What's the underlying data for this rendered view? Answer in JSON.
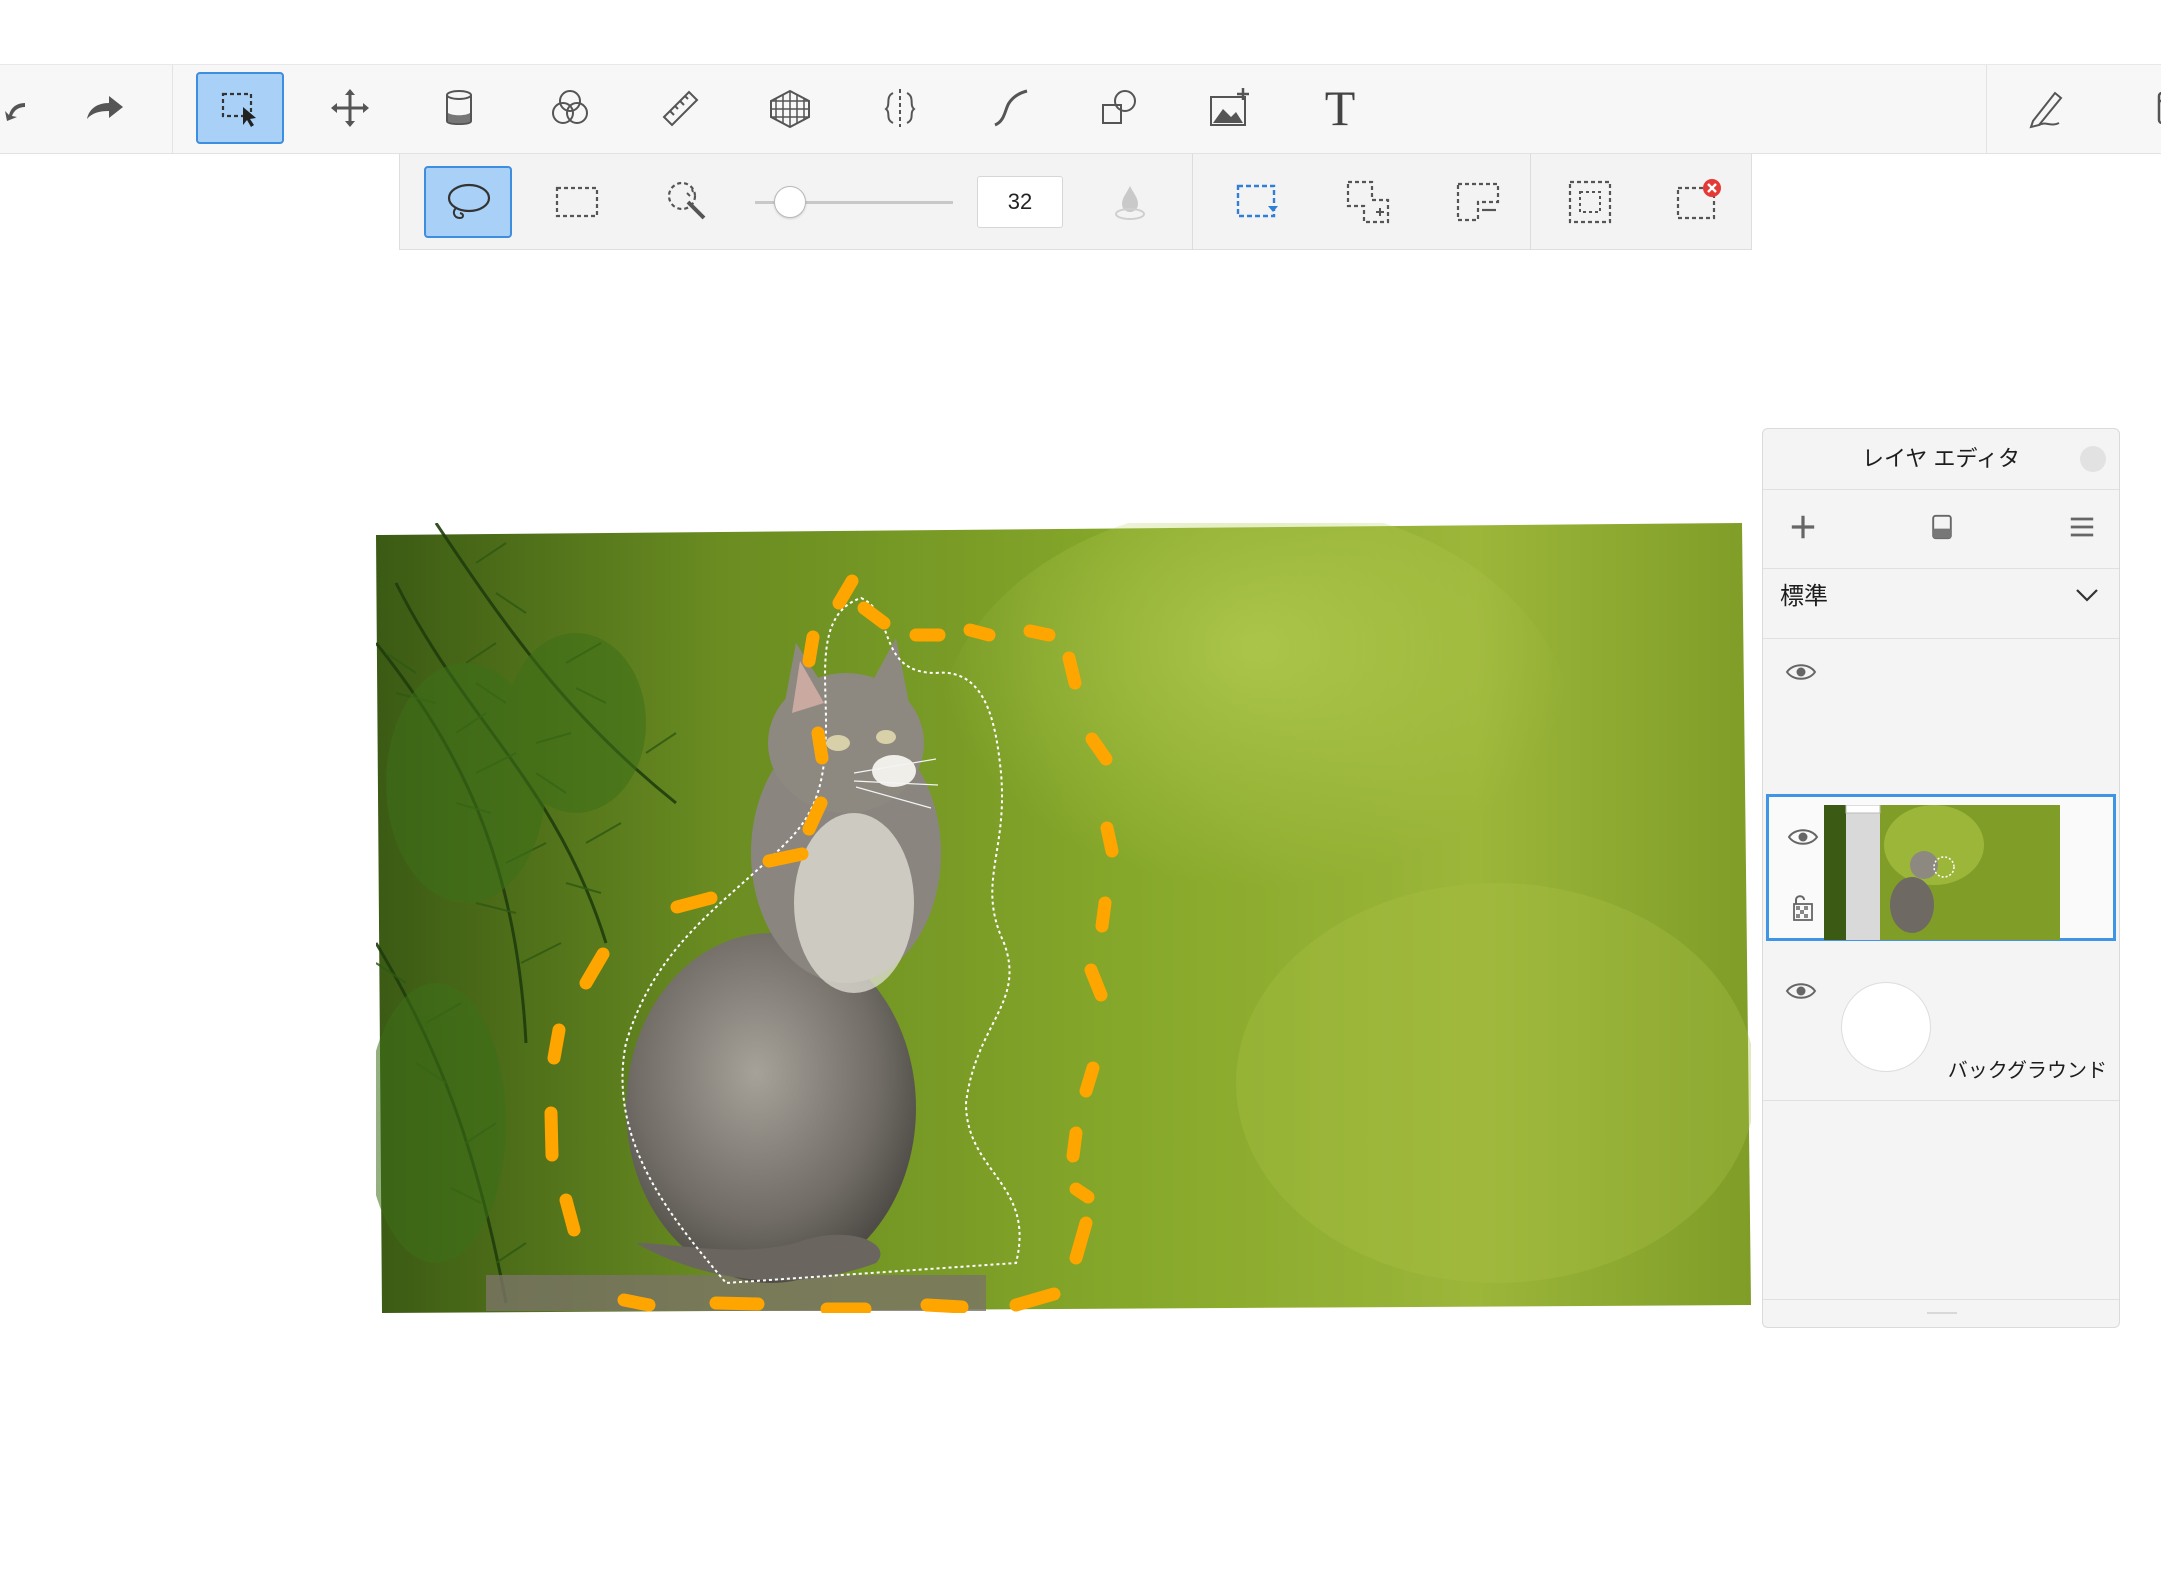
{
  "toolbar": {
    "tools": [
      {
        "name": "undo"
      },
      {
        "name": "redo"
      },
      {
        "name": "selection-tool",
        "active": true
      },
      {
        "name": "transform-tool"
      },
      {
        "name": "fill-tool"
      },
      {
        "name": "blend-tool"
      },
      {
        "name": "ruler-tool"
      },
      {
        "name": "perspective-tool"
      },
      {
        "name": "symmetry-tool"
      },
      {
        "name": "curve-tool"
      },
      {
        "name": "shape-tool"
      },
      {
        "name": "add-image-tool"
      },
      {
        "name": "text-tool"
      },
      {
        "name": "pen-tool"
      },
      {
        "name": "panel-toggle"
      }
    ],
    "text_tool_glyph": "T"
  },
  "selection_toolbar": {
    "modes": [
      "lasso",
      "rectangle",
      "magic-wand"
    ],
    "active_mode": "lasso",
    "brush_size": "32",
    "actions": [
      "new-selection",
      "add-to-selection",
      "subtract-from-selection",
      "invert-selection",
      "deselect"
    ]
  },
  "canvas": {
    "image_subject": "kitten-photo",
    "annotation_color": "#FFA500"
  },
  "layer_editor": {
    "title": "レイヤ エディタ",
    "blend_mode": "標準",
    "layers": [
      {
        "name": "",
        "visible": true,
        "selected": false
      },
      {
        "name": "",
        "visible": true,
        "selected": true,
        "locked_alpha": true
      },
      {
        "name": "バックグラウンド",
        "visible": true,
        "selected": false
      }
    ]
  },
  "colors": {
    "accent": "#3F94E6",
    "active_tool_bg": "#A9D1F7",
    "deselect_red": "#E53935"
  }
}
